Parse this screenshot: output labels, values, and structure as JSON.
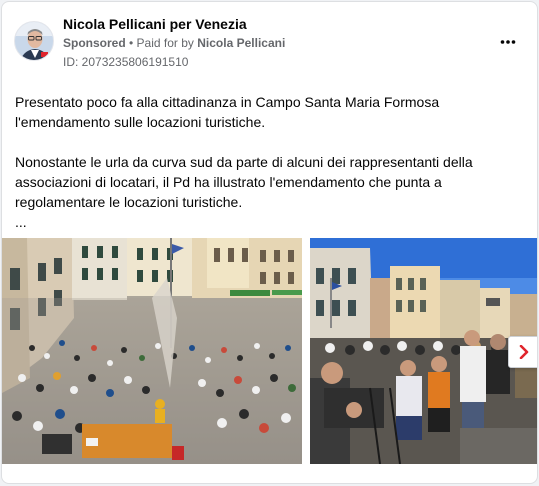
{
  "post": {
    "page_name": "Nicola Pellicani per Venezia",
    "sponsored_label": "Sponsored",
    "separator": " • ",
    "paid_for_prefix": "Paid for by ",
    "payer": "Nicola Pellicani",
    "ad_id": "ID: 2073235806191510",
    "paragraph1": "Presentato poco fa alla cittadinanza in Campo Santa Maria Formosa l'emendamento sulle locazioni turistiche.",
    "paragraph2": "Nonostante le urla da curva sud da parte di alcuni dei rappresentanti della associazioni di locatari, il Pd ha illustrato l'emendamento che punta a regolamentare le locazioni turistiche.",
    "ellipsis": "..."
  },
  "icons": {
    "more": "more-options-icon",
    "next": "chevron-right-icon"
  },
  "colors": {
    "secondary_text": "#65676b",
    "accent_red": "#e0242c"
  }
}
